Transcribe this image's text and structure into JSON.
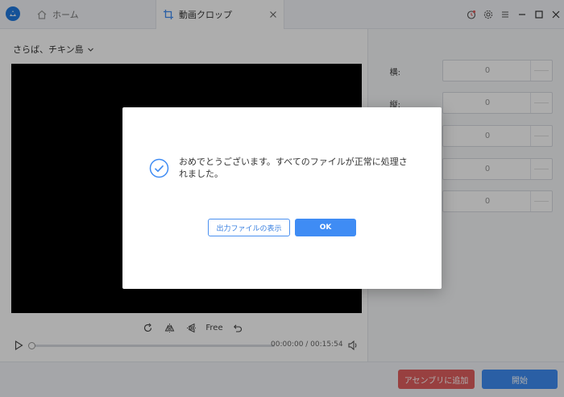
{
  "titlebar": {
    "tabs": [
      {
        "label": "ホーム",
        "icon": "home-icon"
      },
      {
        "label": "動画クロップ",
        "icon": "crop-icon",
        "active": true
      }
    ],
    "window_controls": [
      "timer-icon",
      "gear-icon",
      "menu-icon",
      "minimize-icon",
      "maximize-icon",
      "close-icon"
    ]
  },
  "editor": {
    "file_name": "さらば、チキン島",
    "tools": {
      "rotate_icon": "rotate-icon",
      "flip_h_icon": "flip-horizontal-icon",
      "flip_v_icon": "flip-vertical-icon",
      "ratio_label": "Free",
      "reset_icon": "undo-icon"
    },
    "player": {
      "timecode": "00:00:00 / 00:15:54",
      "progress": 0
    }
  },
  "settings": {
    "fields": [
      {
        "label": "横:",
        "value": "0"
      },
      {
        "label": "縦:",
        "value": "0"
      },
      {
        "label": "",
        "value": "0"
      },
      {
        "label": "",
        "value": "0"
      },
      {
        "label": "",
        "value": "0"
      }
    ]
  },
  "footer": {
    "add_label": "アセンブリに追加",
    "start_label": "開始"
  },
  "dialog": {
    "message": "おめでとうございます。すべてのファイルが正常に処理されました。",
    "show_output_label": "出力ファイルの表示",
    "ok_label": "OK"
  },
  "colors": {
    "accent": "#3f8cf4",
    "danger": "#e15f5f",
    "success_icon": "#3f8cf4"
  }
}
